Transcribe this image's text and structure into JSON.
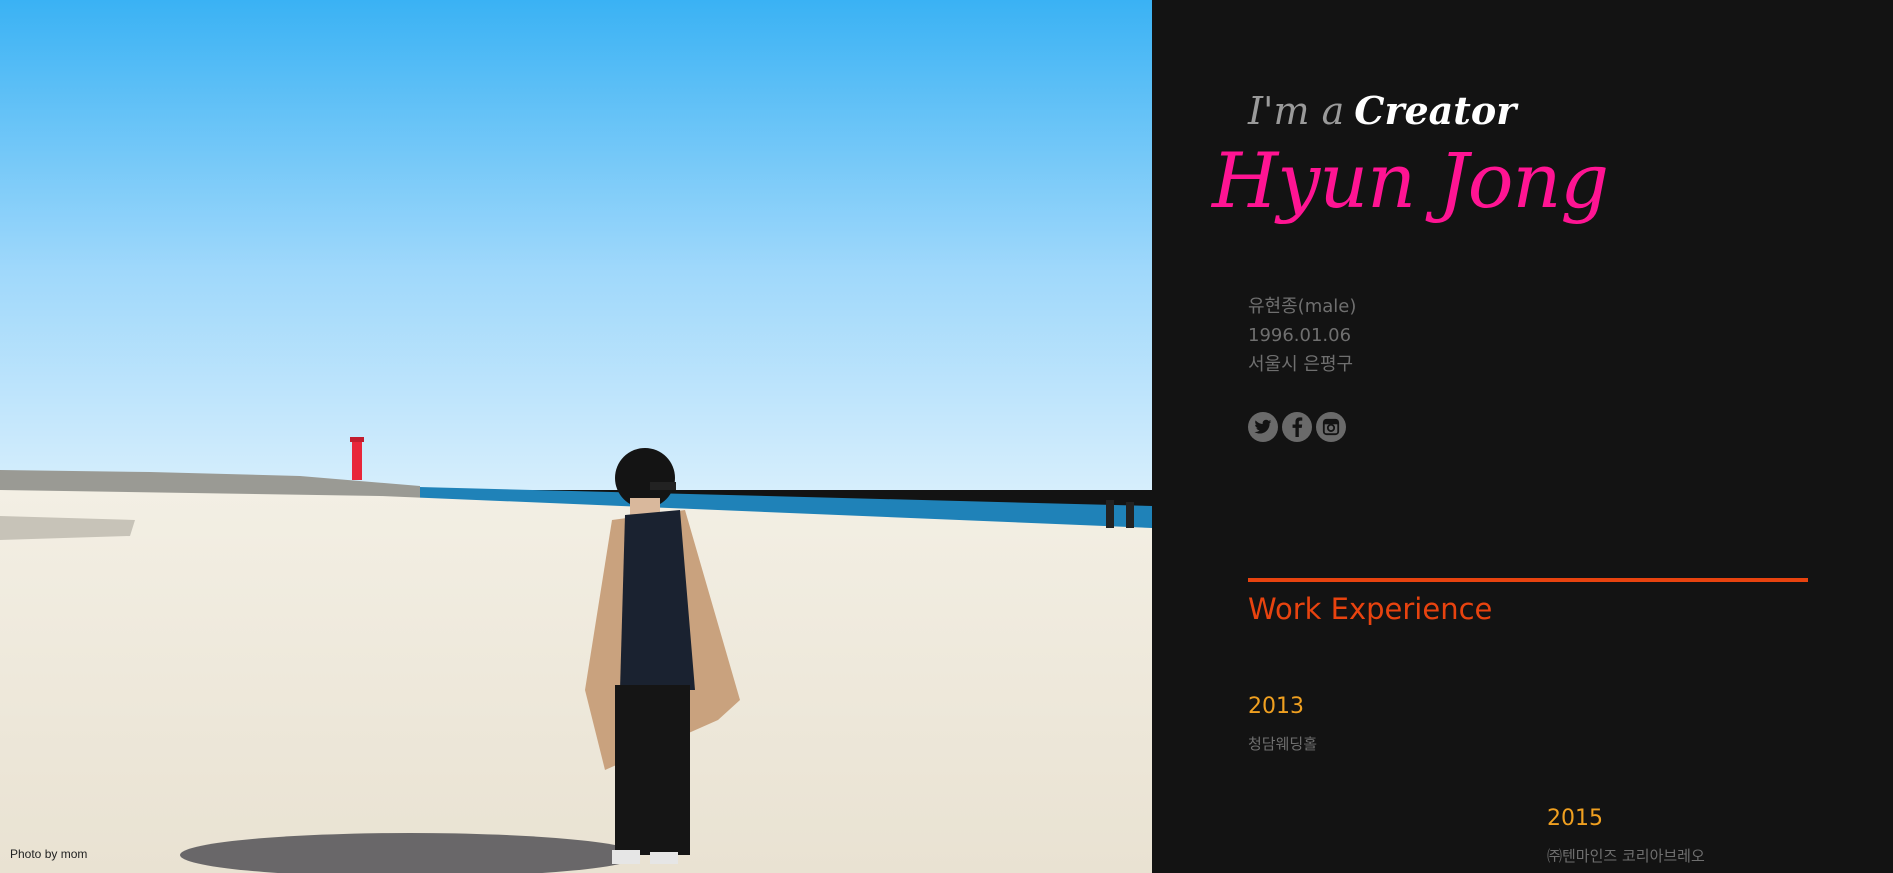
{
  "photo": {
    "alt": "Person in a camel coat standing on a sandy beach with a red lighthouse and blue sea behind",
    "credit": "Photo by mom"
  },
  "intro": {
    "prefix": "I'm a",
    "role": "Creator",
    "name": "Hyun Jong"
  },
  "profile": {
    "name_ko": "유현종(male)",
    "birthdate": "1996.01.06",
    "location": "서울시 은평구"
  },
  "social_links": [
    {
      "name": "twitter",
      "icon": "twitter-icon"
    },
    {
      "name": "facebook",
      "icon": "facebook-icon"
    },
    {
      "name": "instagram",
      "icon": "instagram-icon"
    }
  ],
  "work_experience": {
    "title": "Work Experience",
    "items": [
      {
        "year": "2013",
        "org": "청담웨딩홀"
      },
      {
        "year": "2015",
        "org": "㈜텐마인즈 코리아브레오"
      }
    ]
  },
  "colors": {
    "background": "#131313",
    "name": "#ff1493",
    "accent": "#e8430f",
    "year": "#f0a020",
    "muted": "#6f6f6f"
  }
}
